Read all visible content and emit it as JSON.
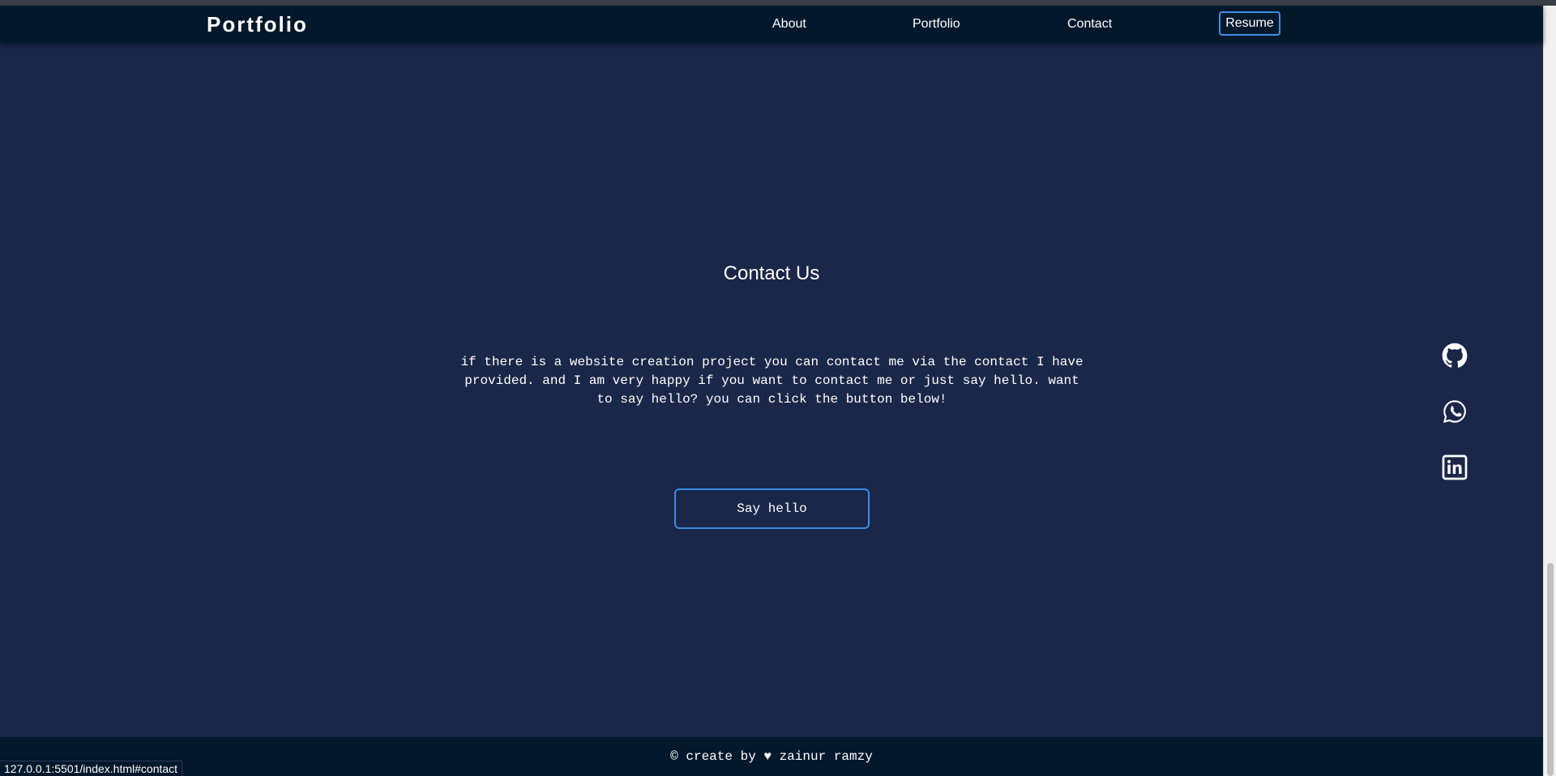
{
  "navbar": {
    "brand": "Portfolio",
    "links": [
      {
        "label": "About"
      },
      {
        "label": "Portfolio"
      },
      {
        "label": "Contact"
      }
    ],
    "resume_label": "Resume"
  },
  "contact": {
    "title": "Contact Us",
    "text": "if there is a website creation project you can contact me via the contact I have provided. and I am very happy if you want to contact me or just say hello. want to say hello? you can click the button below!",
    "button_label": "Say hello"
  },
  "social": {
    "icons": [
      "github-icon",
      "whatsapp-icon",
      "linkedin-icon"
    ]
  },
  "footer": {
    "text": "© create by ♥ zainur ramzy"
  },
  "status_bar": {
    "url": "127.0.0.1:5501/index.html#contact"
  },
  "colors": {
    "background": "#1a2748",
    "navbar": "#04182c",
    "accent_border": "#3a8ee6",
    "text": "#ffffff"
  }
}
